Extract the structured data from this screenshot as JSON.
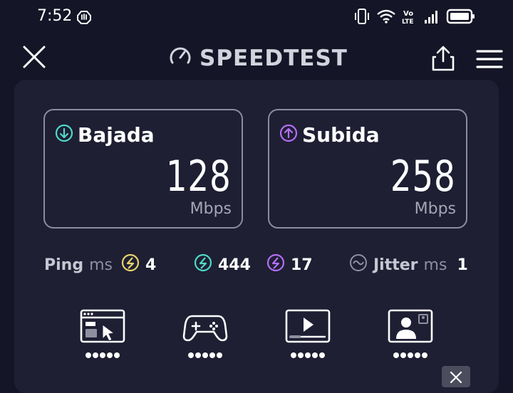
{
  "status_bar": {
    "time": "7:52",
    "network_badge": "Vo\nLTE",
    "icons": [
      "hand-icon",
      "vibrate-icon",
      "wifi-icon",
      "volte-icon",
      "signal-icon",
      "battery-icon"
    ]
  },
  "app_bar": {
    "title": "SPEEDTEST",
    "icons": [
      "close-icon",
      "speedometer-icon",
      "share-icon",
      "menu-icon"
    ]
  },
  "download": {
    "label": "Bajada",
    "value": "128",
    "unit": "Mbps",
    "color": "#4fd8c8"
  },
  "upload": {
    "label": "Subida",
    "value": "258",
    "unit": "Mbps",
    "color": "#b46ef5"
  },
  "ping": {
    "label": "Ping",
    "unit": "ms",
    "idle": "4",
    "download": "444",
    "upload": "17",
    "idle_color": "#e8d36a",
    "download_color": "#4fd8c8",
    "upload_color": "#b46ef5"
  },
  "jitter": {
    "label": "Jitter",
    "unit": "ms",
    "value": "1"
  },
  "experience_tiles": [
    {
      "icon": "web-browsing-icon",
      "rating_dots": 5
    },
    {
      "icon": "gaming-icon",
      "rating_dots": 5
    },
    {
      "icon": "video-streaming-icon",
      "rating_dots": 5
    },
    {
      "icon": "video-call-icon",
      "rating_dots": 5
    }
  ],
  "colors": {
    "background": "#141526",
    "panel": "#1e1f33",
    "border": "#8b8c9c"
  }
}
